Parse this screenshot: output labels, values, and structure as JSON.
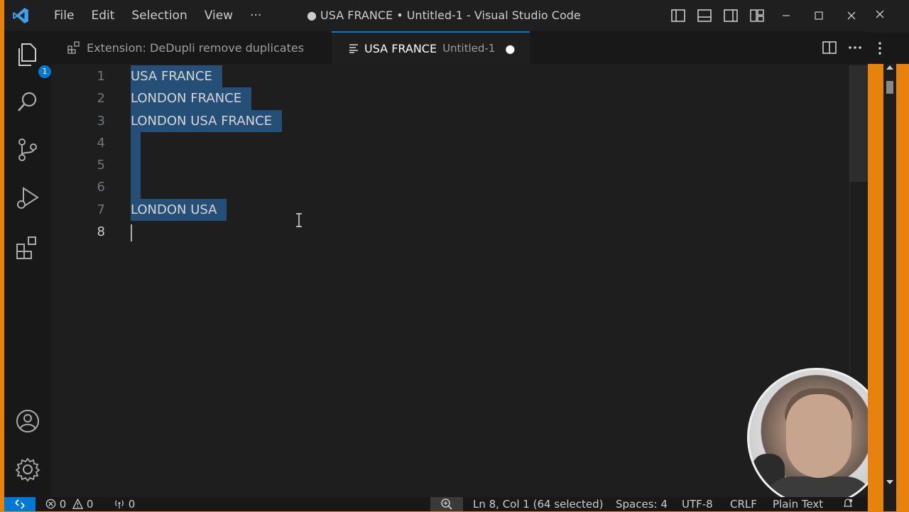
{
  "titlebar": {
    "menu": [
      "File",
      "Edit",
      "Selection",
      "View",
      "···"
    ],
    "window_title": "● USA FRANCE • Untitled-1 - Visual Studio Code"
  },
  "activity": {
    "explorer_badge": "1"
  },
  "tabs": [
    {
      "label": "Extension: DeDupli remove duplicates",
      "icon": "extension-icon"
    },
    {
      "label": "USA FRANCE",
      "sublabel": "Untitled-1",
      "dirty": "●",
      "icon": "text-lines-icon"
    }
  ],
  "editor": {
    "line_numbers": [
      "1",
      "2",
      "3",
      "4",
      "5",
      "6",
      "7",
      "8"
    ],
    "lines": [
      "USA FRANCE",
      "LONDON FRANCE",
      "LONDON USA FRANCE",
      "",
      "",
      "",
      "LONDON USA",
      ""
    ],
    "active_line": "8"
  },
  "status": {
    "errors": "0",
    "warnings": "0",
    "ports": "0",
    "cursor": "Ln 8, Col 1 (64 selected)",
    "spaces": "Spaces: 4",
    "encoding": "UTF-8",
    "eol": "CRLF",
    "language": "Plain Text"
  },
  "colors": {
    "accent": "#0078d4",
    "selection": "#264f78",
    "border_frame": "#e8820e"
  }
}
